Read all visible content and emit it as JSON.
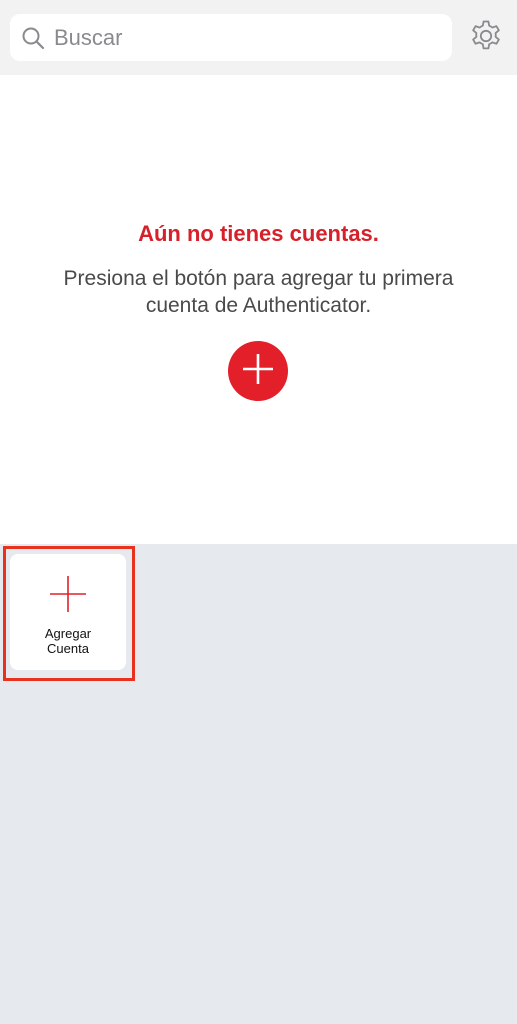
{
  "search": {
    "placeholder": "Buscar",
    "value": "",
    "icon": "search-icon"
  },
  "header": {
    "settings_icon": "gear-icon"
  },
  "empty_state": {
    "title": "Aún no tienes cuentas.",
    "description": "Presiona el botón para agregar tu primera cuenta de Authenticator.",
    "add_icon": "plus-icon"
  },
  "add_account_tile": {
    "label_line1": "Agregar",
    "label_line2": "Cuenta",
    "icon": "plus-icon"
  },
  "colors": {
    "accent": "#e3202a",
    "title": "#d6202a",
    "highlight": "#e8321e",
    "background": "#e6eaee"
  }
}
